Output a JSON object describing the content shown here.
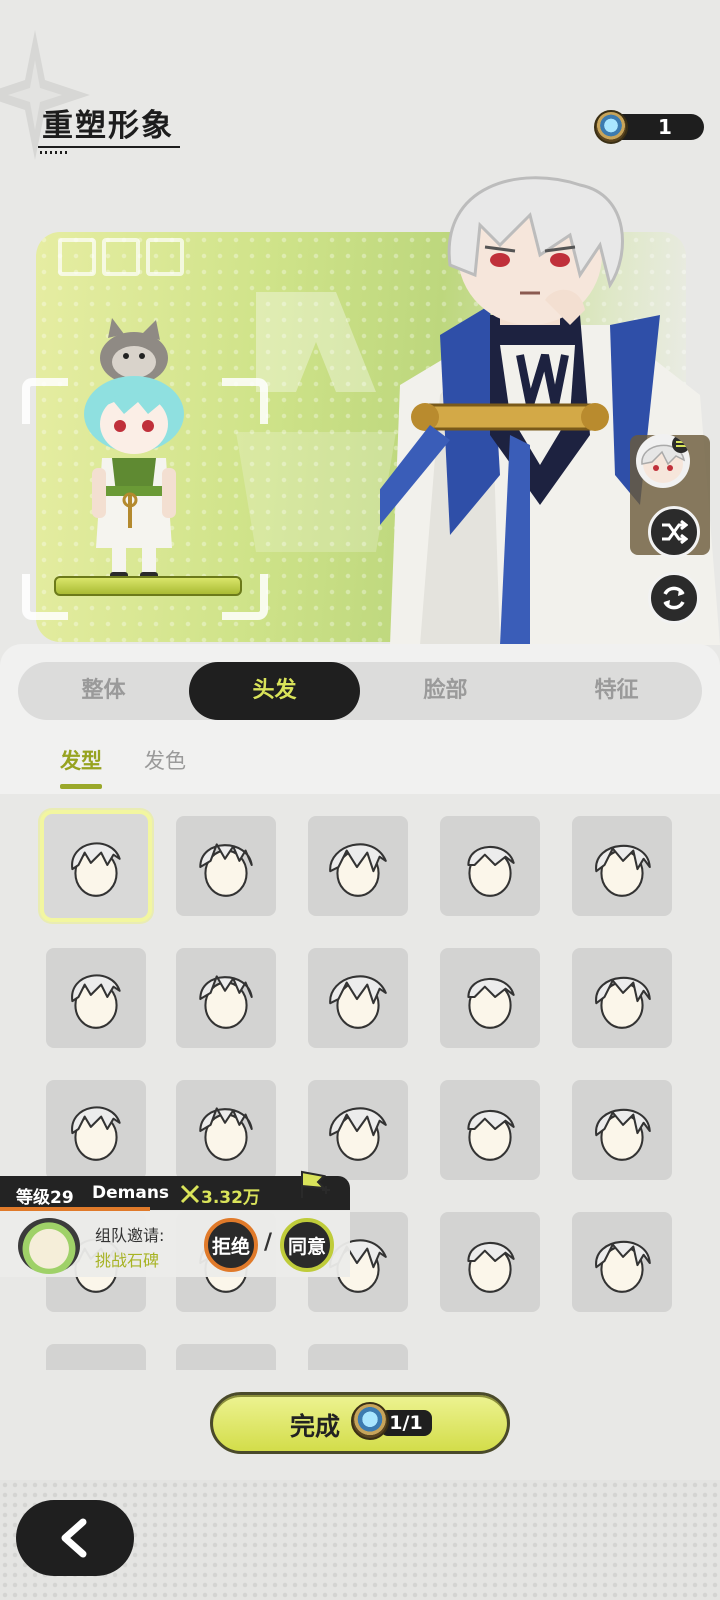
{
  "header": {
    "title": "重塑形象",
    "currency_value": "1",
    "currency_icon": "mirror-token-icon"
  },
  "tabs": [
    {
      "label": "整体",
      "active": false
    },
    {
      "label": "头发",
      "active": true
    },
    {
      "label": "脸部",
      "active": false
    },
    {
      "label": "特征",
      "active": false
    }
  ],
  "subtabs": [
    {
      "label": "发型",
      "active": true
    },
    {
      "label": "发色",
      "active": false
    }
  ],
  "hairstyles": {
    "selected_index": 0,
    "count": 23
  },
  "side_actions": {
    "swap_icon": "swap-character-icon",
    "random_icon": "shuffle-icon",
    "reset_icon": "refresh-icon"
  },
  "notification": {
    "level": "等级29",
    "player": "Demans",
    "power": "3.32万",
    "invite_label": "组队邀请:",
    "invite_target": "挑战石碑",
    "refuse": "拒绝",
    "separator": "/",
    "accept": "同意"
  },
  "done_button": {
    "label": "完成",
    "count": "1/1"
  },
  "colors": {
    "accent": "#d9e35a",
    "dark": "#1f1f1f",
    "refuse": "#e07a2a",
    "banner_green": "#cfe389"
  }
}
